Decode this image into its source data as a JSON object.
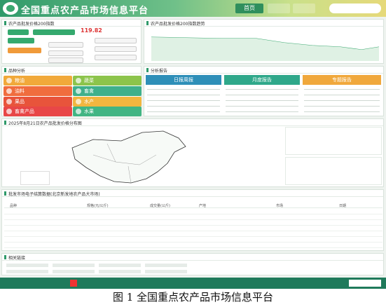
{
  "header": {
    "site_title": "全国重点农产品市场信息平台",
    "home_tab": "首页"
  },
  "price_index_panel": {
    "title": "农产品批发价格200指数",
    "index_value": "119.82",
    "chart_title": "农产品批发价格200指数趋势"
  },
  "categories": {
    "title": "品种分析",
    "items": [
      {
        "label": "粮油",
        "color": "#f1a93a"
      },
      {
        "label": "蔬菜",
        "color": "#8cc44b"
      },
      {
        "label": "油料",
        "color": "#f06d3e"
      },
      {
        "label": "畜禽",
        "color": "#3fb08b"
      },
      {
        "label": "果品",
        "color": "#e8543b"
      },
      {
        "label": "水产",
        "color": "#f2b63f"
      },
      {
        "label": "畜禽产品",
        "color": "#e84747"
      },
      {
        "label": "水果",
        "color": "#41b583"
      }
    ]
  },
  "reports": {
    "title": "分析报告",
    "columns": [
      {
        "label": "日报周报",
        "color": "#2e8fb8"
      },
      {
        "label": "月度报告",
        "color": "#2fa88a"
      },
      {
        "label": "专题报告",
        "color": "#f0a83c"
      }
    ]
  },
  "map": {
    "title": "2025年8月21日农产品批发价格分布图"
  },
  "table": {
    "title": "批发市场电子结算数据(北京新发地农产品大市场)",
    "headers": [
      "品种",
      "规格(元/公斤)",
      "成交量(公斤)",
      "产地",
      "市场",
      "日期"
    ]
  },
  "links": {
    "title": "相关链接"
  },
  "caption": "图 1  全国重点农产品市场信息平台"
}
